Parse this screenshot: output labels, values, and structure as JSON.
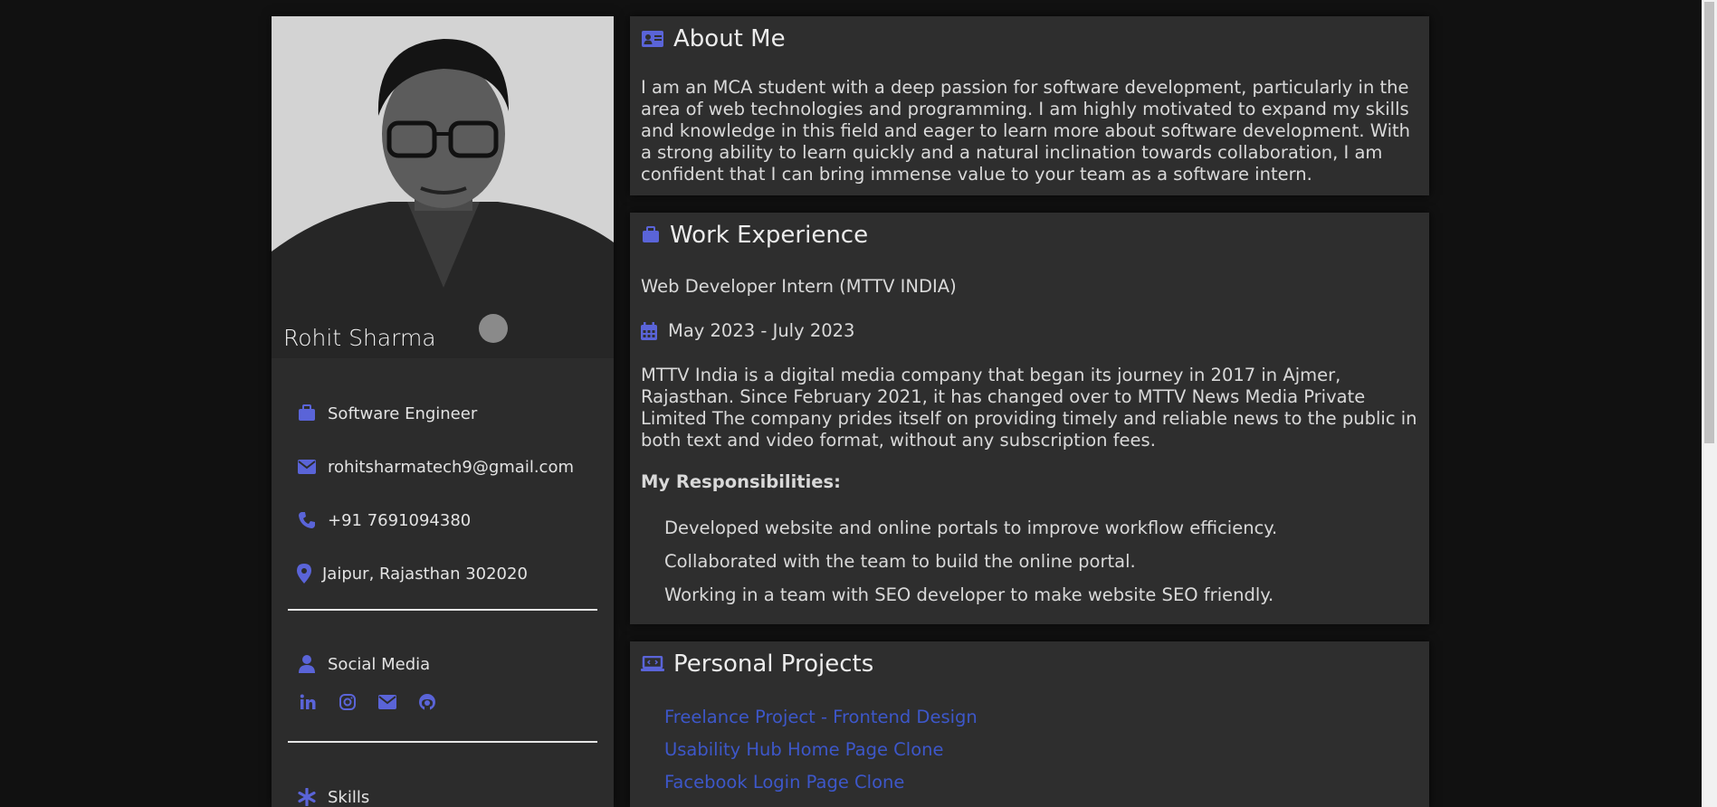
{
  "profile": {
    "name": "Rohit Sharma",
    "title": "Software Engineer",
    "email": "rohitsharmatech9@gmail.com",
    "phone": "+91 7691094380",
    "location": "Jaipur, Rajasthan 302020",
    "social_heading": "Social Media",
    "social_icons": [
      "linkedin-icon",
      "instagram-icon",
      "mail-icon",
      "github-icon"
    ],
    "skills_heading": "Skills"
  },
  "about": {
    "heading": "About Me",
    "text": "I am an MCA student with a deep passion for software development, particularly in the area of web technologies and programming. I am highly motivated to expand my skills and knowledge in this field and eager to learn more about software development. With a strong ability to learn quickly and a natural inclination towards collaboration, I am confident that I can bring immense value to your team as a software intern."
  },
  "work": {
    "heading": "Work Experience",
    "role": "Web Developer Intern (MTTV INDIA)",
    "dates": "May 2023 - July 2023",
    "description": "MTTV India is a digital media company that began its journey in 2017 in Ajmer, Rajasthan. Since February 2021, it has changed over to MTTV News Media Private Limited The company prides itself on providing timely and reliable news to the public in both text and video format, without any subscription fees.",
    "responsibilities_heading": "My Responsibilities:",
    "responsibilities": [
      "Developed website and online portals to improve workflow efficiency.",
      "Collaborated with the team to build the online portal.",
      "Working in a team with SEO developer to make website SEO friendly."
    ]
  },
  "projects": {
    "heading": "Personal Projects",
    "items": [
      "Freelance Project - Frontend Design",
      "Usability Hub Home Page Clone",
      "Facebook Login Page Clone"
    ]
  },
  "colors": {
    "accent": "#5a64d8",
    "link": "#3d57c9",
    "card": "#2e2e2e",
    "background": "#111111"
  }
}
